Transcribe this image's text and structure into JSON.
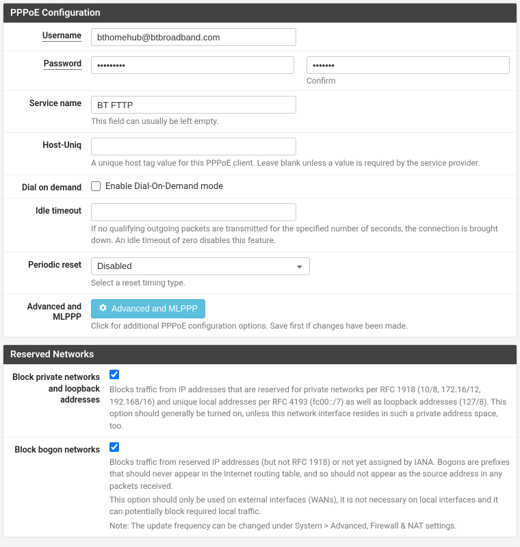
{
  "pppoe": {
    "title": "PPPoE Configuration",
    "username": {
      "label": "Username",
      "value": "bthomehub@btbroadband.com"
    },
    "password": {
      "label": "Password",
      "value": "•••••••••",
      "confirm_value": "•••••••",
      "confirm_label": "Confirm"
    },
    "service_name": {
      "label": "Service name",
      "value": "BT FTTP",
      "help": "This field can usually be left empty."
    },
    "host_uniq": {
      "label": "Host-Uniq",
      "value": "",
      "help": "A unique host tag value for this PPPoE client. Leave blank unless a value is required by the service provider."
    },
    "dial_on_demand": {
      "label": "Dial on demand",
      "checkbox_label": "Enable Dial-On-Demand mode",
      "checked": false
    },
    "idle_timeout": {
      "label": "Idle timeout",
      "value": "",
      "help": "If no qualifying outgoing packets are transmitted for the specified number of seconds, the connection is brought down. An idle timeout of zero disables this feature."
    },
    "periodic_reset": {
      "label": "Periodic reset",
      "value": "Disabled",
      "help": "Select a reset timing type."
    },
    "advanced": {
      "label": "Advanced and MLPPP",
      "button": "Advanced and MLPPP",
      "help": "Click for additional PPPoE configuration options. Save first if changes have been made."
    }
  },
  "reserved": {
    "title": "Reserved Networks",
    "block_private": {
      "label": "Block private networks and loopback addresses",
      "checked": true,
      "help": "Blocks traffic from IP addresses that are reserved for private networks per RFC 1918 (10/8, 172.16/12, 192.168/16) and unique local addresses per RFC 4193 (fc00::/7) as well as loopback addresses (127/8). This option should generally be turned on, unless this network interface resides in such a private address space, too."
    },
    "block_bogon": {
      "label": "Block bogon networks",
      "checked": true,
      "help1": "Blocks traffic from reserved IP addresses (but not RFC 1918) or not yet assigned by IANA. Bogons are prefixes that should never appear in the Internet routing table, and so should not appear as the source address in any packets received.",
      "help2": "This option should only be used on external interfaces (WANs), it is not necessary on local interfaces and it can potentially block required local traffic.",
      "help3": "Note: The update frequency can be changed under System > Advanced, Firewall & NAT settings."
    }
  }
}
